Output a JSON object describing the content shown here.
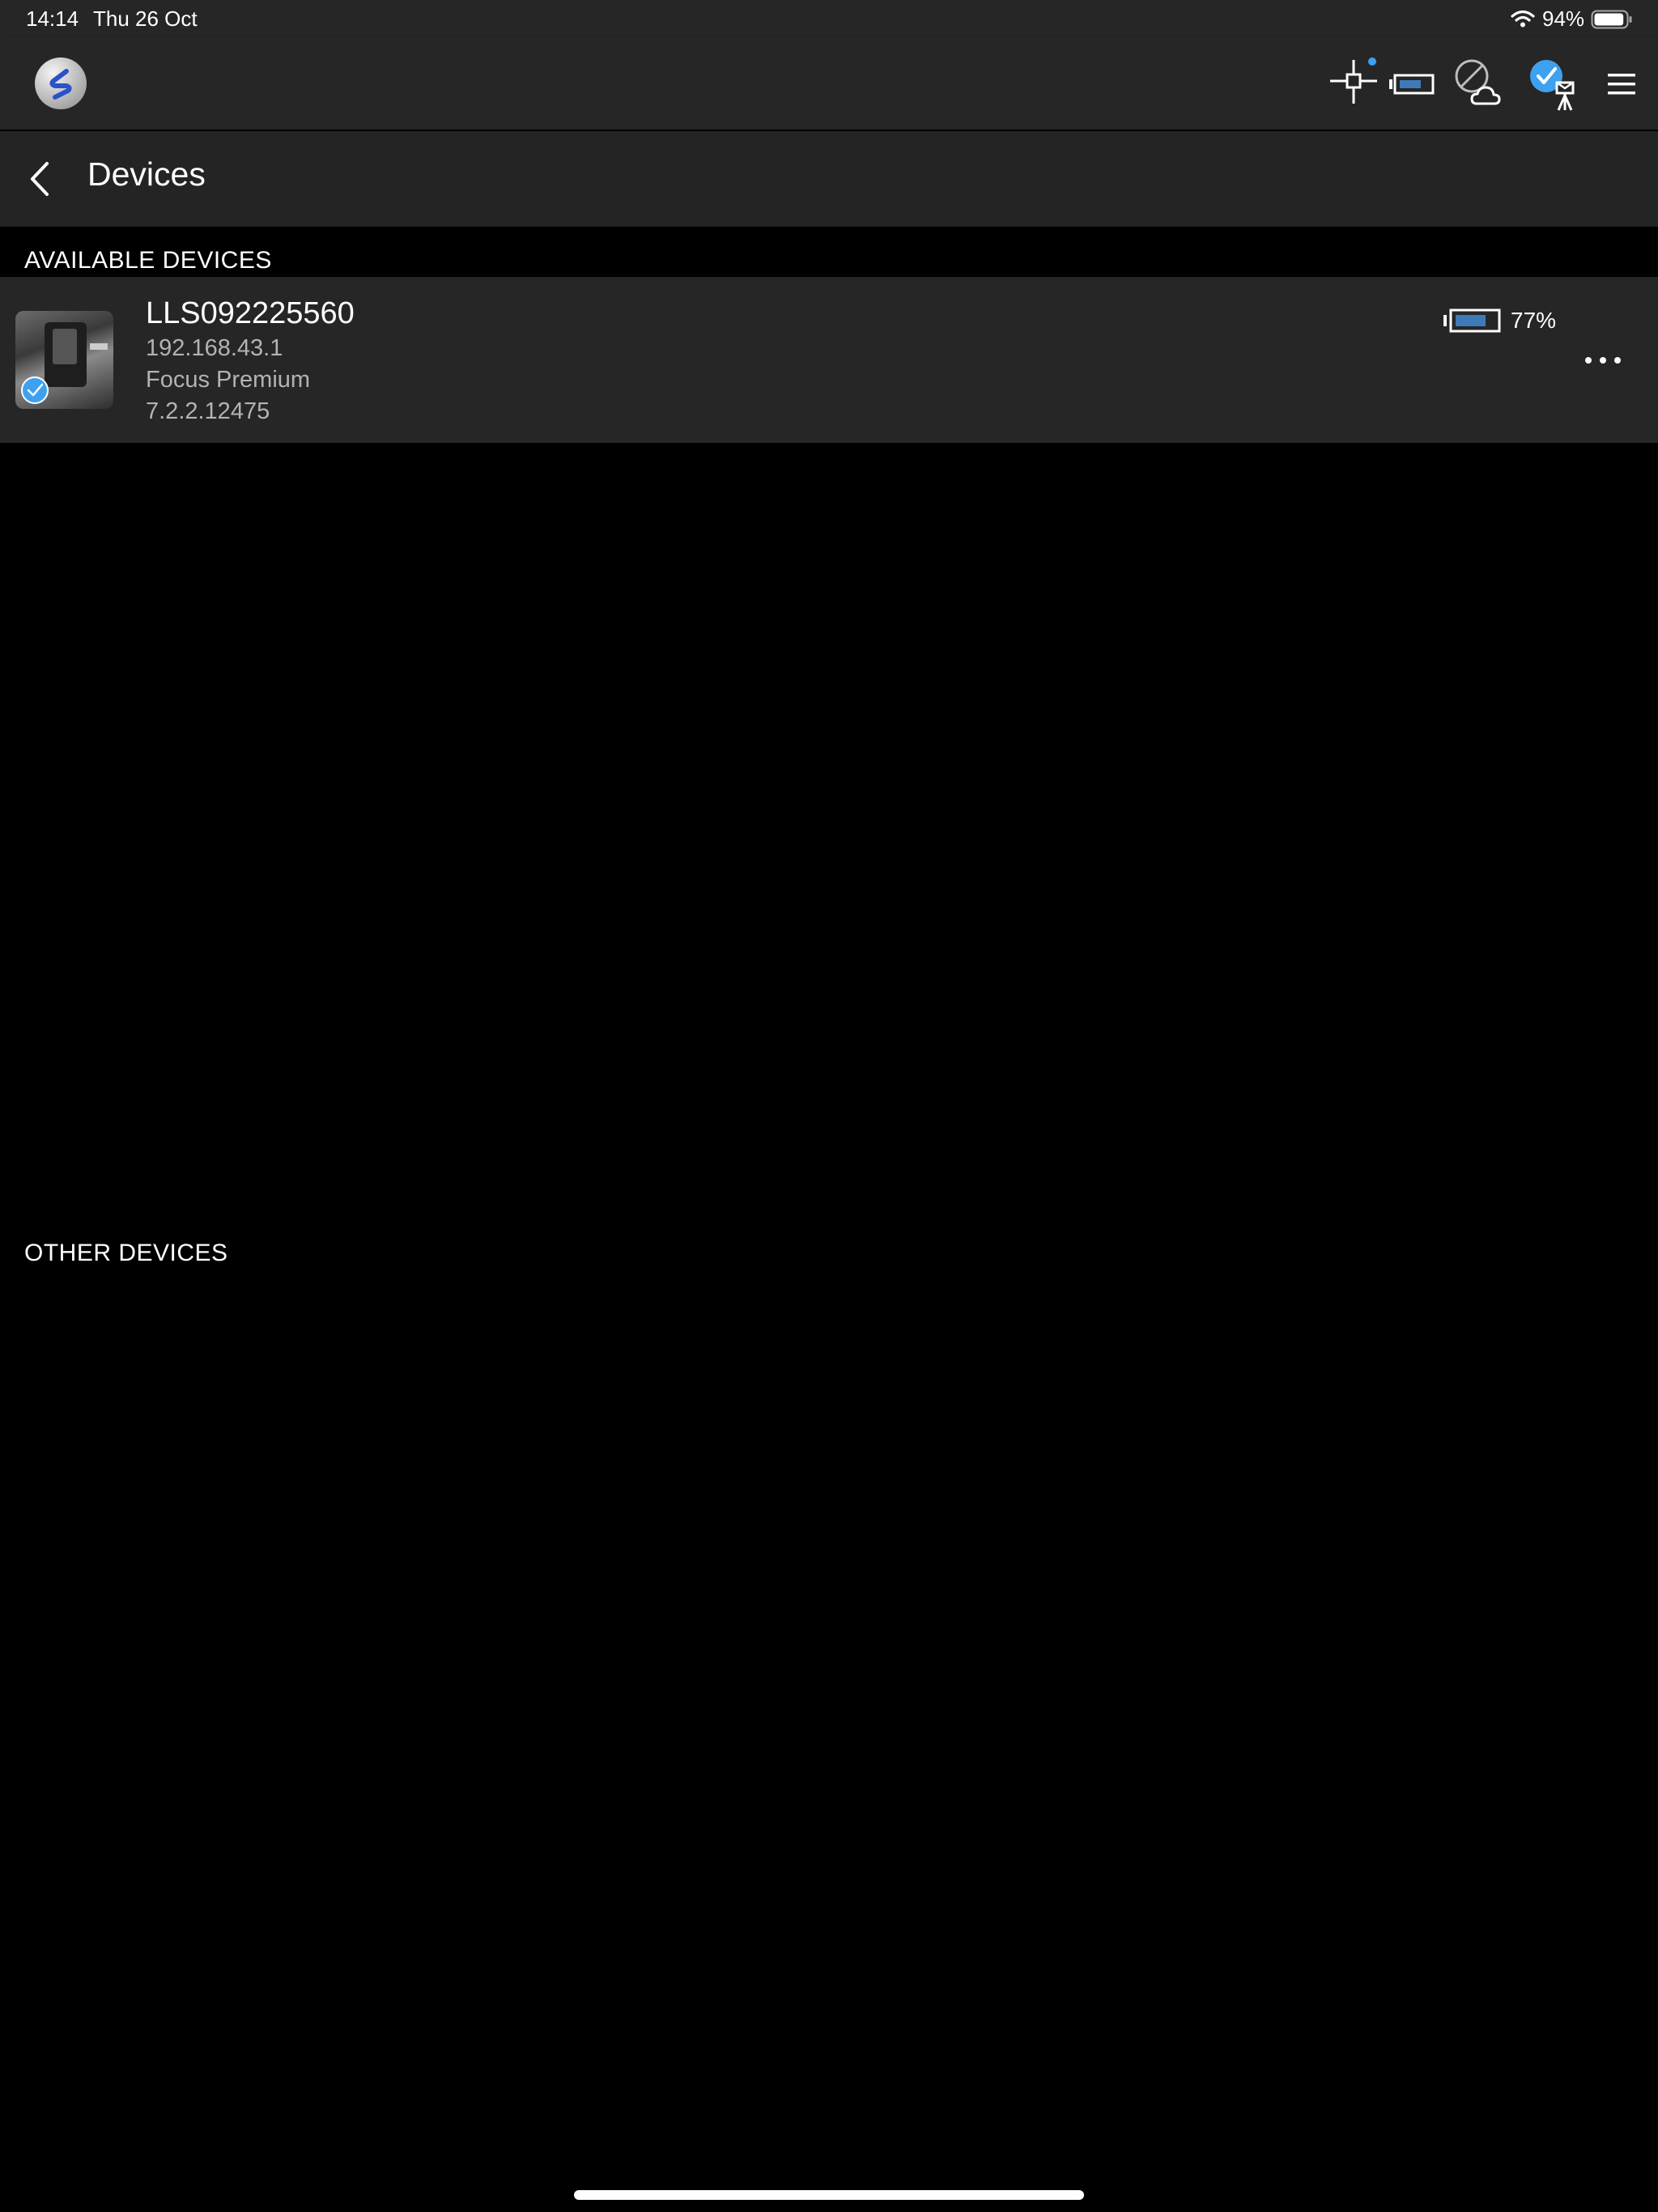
{
  "status_bar": {
    "time": "14:14",
    "date": "Thu 26 Oct",
    "battery_percent_text": "94%",
    "battery_level": 0.94,
    "wifi_icon": "wifi-icon"
  },
  "toolbar": {
    "logo_icon": "app-logo-icon",
    "icons": [
      "crosshair-target-icon",
      "scanner-battery-icon",
      "cloud-disabled-icon",
      "connected-scanner-icon",
      "hamburger-menu-icon"
    ],
    "accent_color": "#3ea1f0"
  },
  "header": {
    "back_icon": "chevron-left-icon",
    "title": "Devices"
  },
  "sections": {
    "available_heading": "AVAILABLE DEVICES",
    "other_heading": "OTHER DEVICES"
  },
  "devices": [
    {
      "name": "LLS092225560",
      "ip": "192.168.43.1",
      "model": "Focus Premium",
      "firmware": "7.2.2.12475",
      "battery_text": "77%",
      "battery_level": 0.77,
      "selected": true,
      "more_icon": "more-horizontal-icon"
    }
  ]
}
